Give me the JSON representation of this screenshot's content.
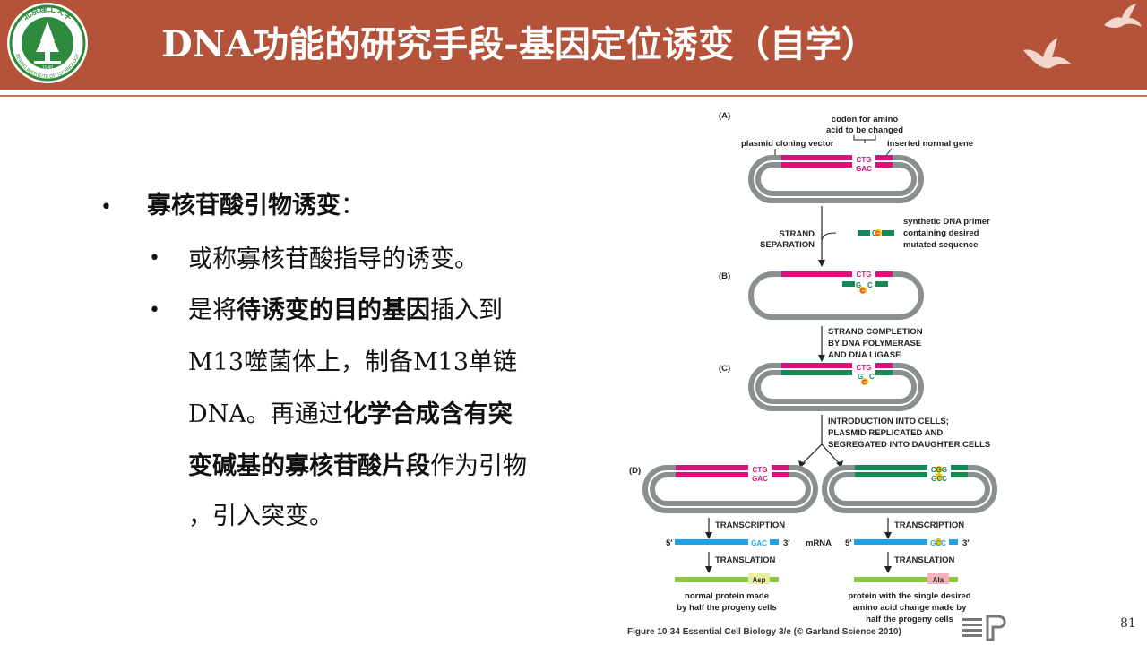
{
  "header": {
    "title": "DNA功能的研究手段-基因定位诱变（自学）"
  },
  "logo": {
    "name": "university-seal",
    "text_top": "北京理工大学",
    "text_bottom": "BEIJING INSTITUTE OF TECHNOLOGY",
    "year": "1940"
  },
  "content": {
    "l1_bold": "寡核苷酸引物诱变",
    "l1_rest": "：",
    "l2a": "或称寡核苷酸指导的诱变。",
    "l2b_pre": "是将",
    "l2b_bold": "待诱变的目的基因",
    "l2b_post": "插入到",
    "l2c": "M13噬菌体上，制备M13单链",
    "l2d_pre": "DNA。再通过",
    "l2d_bold": "化学合成含有突",
    "l2e_bold": "变碱基的寡核苷酸片段",
    "l2e_post": "作为引物",
    "l2f": "，引入突变。",
    "bullet": "•"
  },
  "figure": {
    "A": "(A)",
    "B": "(B)",
    "C": "(C)",
    "D": "(D)",
    "codon_label1": "codon for amino",
    "codon_label2": "acid to be changed",
    "vector_label": "plasmid cloning vector",
    "gene_label": "inserted normal gene",
    "ctg": "CTG",
    "gac": "GAC",
    "strand1": "STRAND",
    "strand2": "SEPARATION",
    "primer1": "synthetic DNA primer",
    "primer2": "containing desired",
    "primer3": "mutated sequence",
    "primer_g": "G",
    "primer_c": "C",
    "comp1": "STRAND COMPLETION",
    "comp2": "BY DNA POLYMERASE",
    "comp3": "AND DNA LIGASE",
    "intro1": "INTRODUCTION INTO CELLS;",
    "intro2": "PLASMID REPLICATED AND",
    "intro3": "SEGREGATED INTO DAUGHTER CELLS",
    "cgg": "CGG",
    "gcc": "GCC",
    "transcription": "TRANSCRIPTION",
    "translation": "TRANSLATION",
    "five": "5′",
    "three": "3′",
    "mrna": "mRNA",
    "asp": "Asp",
    "ala": "Ala",
    "left1": "normal protein made",
    "left2": "by half the progeny cells",
    "right1": "protein with the single desired",
    "right2": "amino acid change made by",
    "right3": "half the progeny cells"
  },
  "caption": "Figure 10-34  Essential Cell Biology 3/e (© Garland Science 2010)",
  "page_number": "81",
  "colors": {
    "header": "#b5533a",
    "pink": "#d9127a",
    "green": "#138a55",
    "blue": "#1fa3e6",
    "lime": "#8cc63f",
    "gray": "#8a8f8f"
  }
}
